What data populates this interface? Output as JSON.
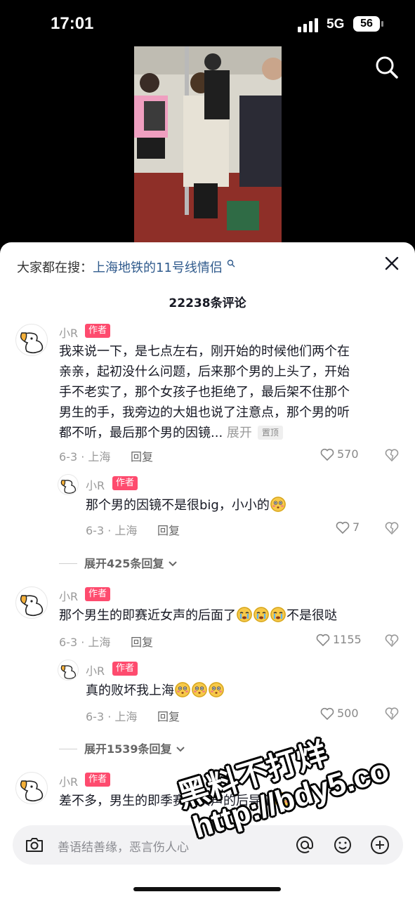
{
  "status_bar": {
    "time": "17:01",
    "network": "5G",
    "battery": "56"
  },
  "sheet": {
    "search_prefix": "大家都在搜：",
    "search_term": "上海地铁的11号线情侣",
    "comment_count": "22238条评论"
  },
  "comments": [
    {
      "user": "小R",
      "tag": "作者",
      "lines": [
        "我来说一下，是七点左右，刚开始的时候他们两个在",
        "亲亲，起初没什么问题，后来那个男的上头了，开始",
        "手不老实了，那个女孩子也拒绝了，最后架不住那个",
        "男生的手，我旁边的大姐也说了注意点，那个男的听",
        "都不听，最后那个男的因镜..."
      ],
      "expand_label": "展开",
      "pin_label": "置顶",
      "date_loc": "6-3 · 上海",
      "reply_label": "回复",
      "likes": "570",
      "reply": {
        "user": "小R",
        "tag": "作者",
        "text": "那个男的因镜不是很big，小小的",
        "date_loc": "6-3 · 上海",
        "reply_label": "回复",
        "likes": "7"
      },
      "more_replies": "展开425条回复"
    },
    {
      "user": "小R",
      "tag": "作者",
      "text_a": "那个男生的即赛近女声的后面了",
      "text_b": "不是很哒",
      "date_loc": "6-3 · 上海",
      "reply_label": "回复",
      "likes": "1155",
      "reply": {
        "user": "小R",
        "tag": "作者",
        "text": "真的败坏我上海",
        "date_loc": "6-3 · 上海",
        "reply_label": "回复",
        "likes": "500"
      },
      "more_replies": "展开1539条回复"
    },
    {
      "user": "小R",
      "tag": "作者",
      "text": "差不多，男生的即季赛近女声的后导了"
    }
  ],
  "input": {
    "placeholder": "善语结善缘，恶言伤人心"
  },
  "watermark": {
    "line1": "黑料不打烊",
    "line2": "http://bdy5.co"
  },
  "colors": {
    "author_tag": "#fe2c55",
    "search_link": "#2f5a8c"
  }
}
